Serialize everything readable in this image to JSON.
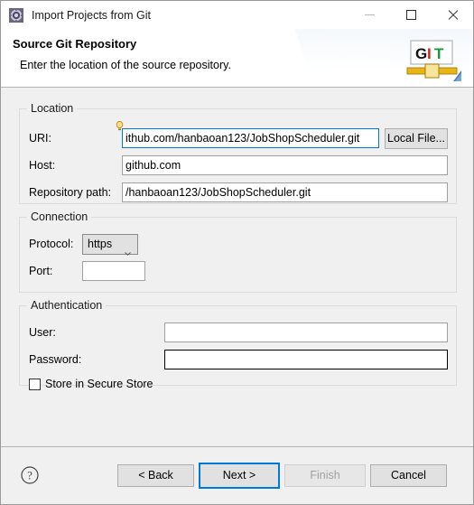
{
  "window": {
    "title": "Import Projects from Git",
    "icon": "eclipse-wizard-icon",
    "controls": {
      "minimize": "minimize-icon",
      "maximize": "maximize-icon",
      "close": "close-icon"
    }
  },
  "header": {
    "title": "Source Git Repository",
    "description": "Enter the location of the source repository.",
    "logo_text_g": "G",
    "logo_text_i": "I",
    "logo_text_t": "T",
    "logo_name": "git-logo"
  },
  "location": {
    "group_title": "Location",
    "uri_label": "URI:",
    "uri_value": "ithub.com/hanbaoan123/JobShopScheduler.git",
    "uri_placeholder": "",
    "uri_decoration": "content-assist-hint-icon",
    "local_file_button": "Local File...",
    "host_label": "Host:",
    "host_value": "github.com",
    "host_placeholder": "",
    "repository_path_label": "Repository path:",
    "repository_path_value": "/hanbaoan123/JobShopScheduler.git",
    "repository_path_placeholder": ""
  },
  "connection": {
    "group_title": "Connection",
    "protocol_label": "Protocol:",
    "protocol_value": "https",
    "protocol_options": [
      "https"
    ],
    "port_label": "Port:",
    "port_value": "",
    "port_placeholder": ""
  },
  "authentication": {
    "group_title": "Authentication",
    "user_label": "User:",
    "user_value": "",
    "user_placeholder": "",
    "password_label": "Password:",
    "password_value": "",
    "password_placeholder": "",
    "store_checkbox_label": "Store in Secure Store",
    "store_checkbox_checked": false
  },
  "footer": {
    "help_icon": "help-icon",
    "back_label": "< Back",
    "next_label": "Next >",
    "finish_label": "Finish",
    "cancel_label": "Cancel",
    "finish_enabled": false,
    "default_button": "Next >"
  },
  "colors": {
    "accent": "#0078d7",
    "dialog_bg": "#f0f0f0",
    "header_bg": "#ffffff",
    "group_border": "#dcdcdc",
    "disabled_text": "#a0a0a0"
  }
}
